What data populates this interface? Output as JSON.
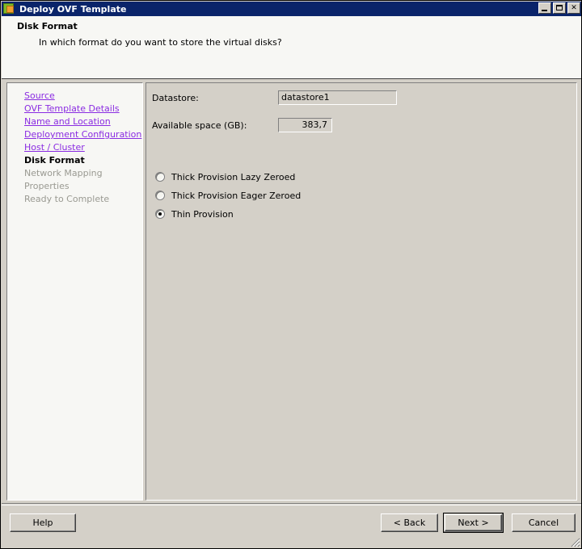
{
  "window": {
    "title": "Deploy OVF Template",
    "icon": "ovf-template-icon",
    "titlebar_color": "#0a246a",
    "body_color": "#d4d0c8",
    "controls": {
      "minimize_label": "_",
      "maximize_label": "□",
      "close_label": "✕"
    }
  },
  "header": {
    "title": "Disk Format",
    "subtitle": "In which format do you want to store the virtual disks?"
  },
  "nav": {
    "link_color": "#8a2be2",
    "items": [
      {
        "label": "Source",
        "state": "link"
      },
      {
        "label": "OVF Template Details",
        "state": "link"
      },
      {
        "label": "Name and Location",
        "state": "link"
      },
      {
        "label": "Deployment Configuration",
        "state": "link"
      },
      {
        "label": "Host / Cluster",
        "state": "link"
      },
      {
        "label": "Disk Format",
        "state": "current"
      },
      {
        "label": "Network Mapping",
        "state": "future"
      },
      {
        "label": "Properties",
        "state": "future"
      },
      {
        "label": "Ready to Complete",
        "state": "future"
      }
    ]
  },
  "content": {
    "datastore": {
      "label": "Datastore:",
      "value": "datastore1"
    },
    "available_space": {
      "label": "Available space (GB):",
      "value": "383,7"
    },
    "disk_format_options": [
      {
        "label": "Thick Provision Lazy Zeroed",
        "selected": false
      },
      {
        "label": "Thick Provision Eager Zeroed",
        "selected": false
      },
      {
        "label": "Thin Provision",
        "selected": true
      }
    ]
  },
  "footer": {
    "help_label": "Help",
    "back_label": "< Back",
    "next_label": "Next >",
    "cancel_label": "Cancel"
  }
}
